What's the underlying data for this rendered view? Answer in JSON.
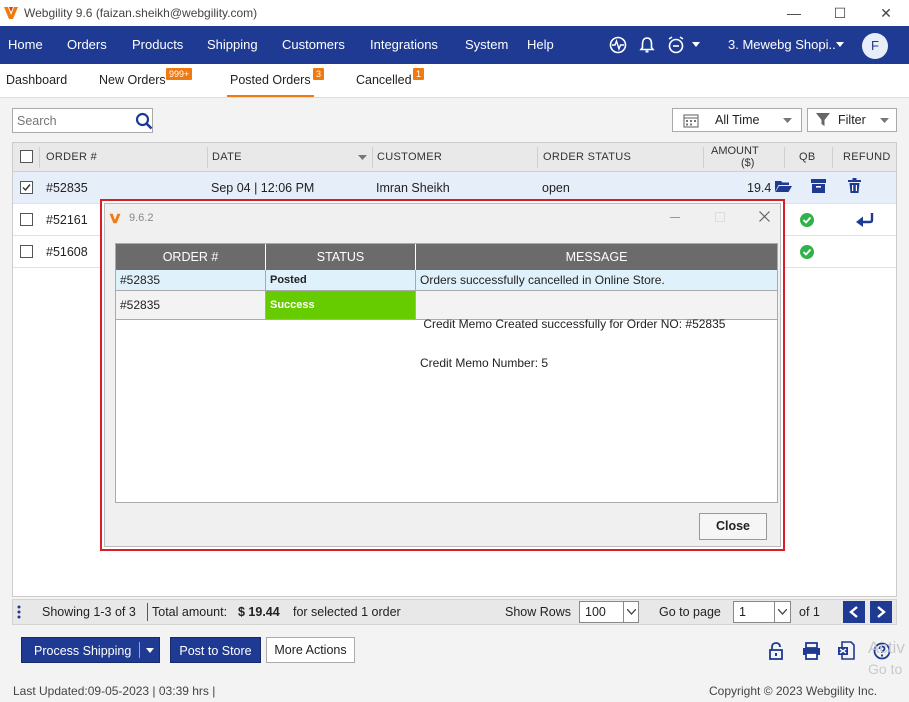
{
  "window": {
    "title": "Webgility 9.6 (faizan.sheikh@webgility.com)"
  },
  "nav": {
    "items": [
      "Home",
      "Orders",
      "Products",
      "Shipping",
      "Customers",
      "Integrations",
      "System",
      "Help"
    ],
    "store": "3. Mewebg Shopi..",
    "avatar": "F"
  },
  "tabs": {
    "dashboard": "Dashboard",
    "new_orders": "New Orders",
    "new_orders_badge": "999+",
    "posted_orders": "Posted Orders",
    "posted_orders_badge": "3",
    "cancelled": "Cancelled",
    "cancelled_badge": "1"
  },
  "toolbar": {
    "search_placeholder": "Search",
    "time_filter": "All Time",
    "filter": "Filter"
  },
  "table": {
    "headers": {
      "order": "ORDER #",
      "date": "DATE",
      "customer": "CUSTOMER",
      "status": "ORDER STATUS",
      "amount_line1": "AMOUNT",
      "amount_line2": "($)",
      "qb": "QB",
      "refund": "REFUND"
    },
    "rows": [
      {
        "order": "#52835",
        "date": "Sep 04 | 12:06 PM",
        "customer": "Imran Sheikh",
        "status": "open",
        "amount": "19.4"
      },
      {
        "order": "#52161"
      },
      {
        "order": "#51608"
      }
    ]
  },
  "dialog": {
    "title": "9.6.2",
    "headers": {
      "order": "ORDER #",
      "status": "STATUS",
      "message": "MESSAGE"
    },
    "rows": [
      {
        "order": "#52835",
        "status": "Posted",
        "message_1": "Orders successfully cancelled in Online Store.",
        "message_2": ""
      },
      {
        "order": "#52835",
        "status": "Success",
        "message_1": " Credit Memo Created successfully for Order NO: #52835",
        "message_2": "Credit Memo Number: 5"
      }
    ],
    "close": "Close"
  },
  "status_bar": {
    "showing": "Showing 1-3 of 3",
    "total_label": "Total amount:",
    "total_value": "$ 19.44",
    "selected": "for selected 1 order",
    "show_rows_label": "Show Rows",
    "show_rows_value": "100",
    "goto_label": "Go to page",
    "goto_value": "1",
    "of_pages": "of 1"
  },
  "actions": {
    "process_shipping": "Process Shipping",
    "post_to_store": "Post to Store",
    "more_actions": "More Actions"
  },
  "footer": {
    "last_updated": "Last Updated:09-05-2023 | 03:39 hrs |",
    "copyright": "Copyright © 2023 Webgility Inc.",
    "activate_1": "Activ",
    "activate_2": "Go to"
  },
  "colors": {
    "nav_bg": "#1f3a93",
    "badge": "#f07a10",
    "success": "#66cc00",
    "posted_row": "#dff1fb",
    "dialog_border": "#d81e28"
  }
}
